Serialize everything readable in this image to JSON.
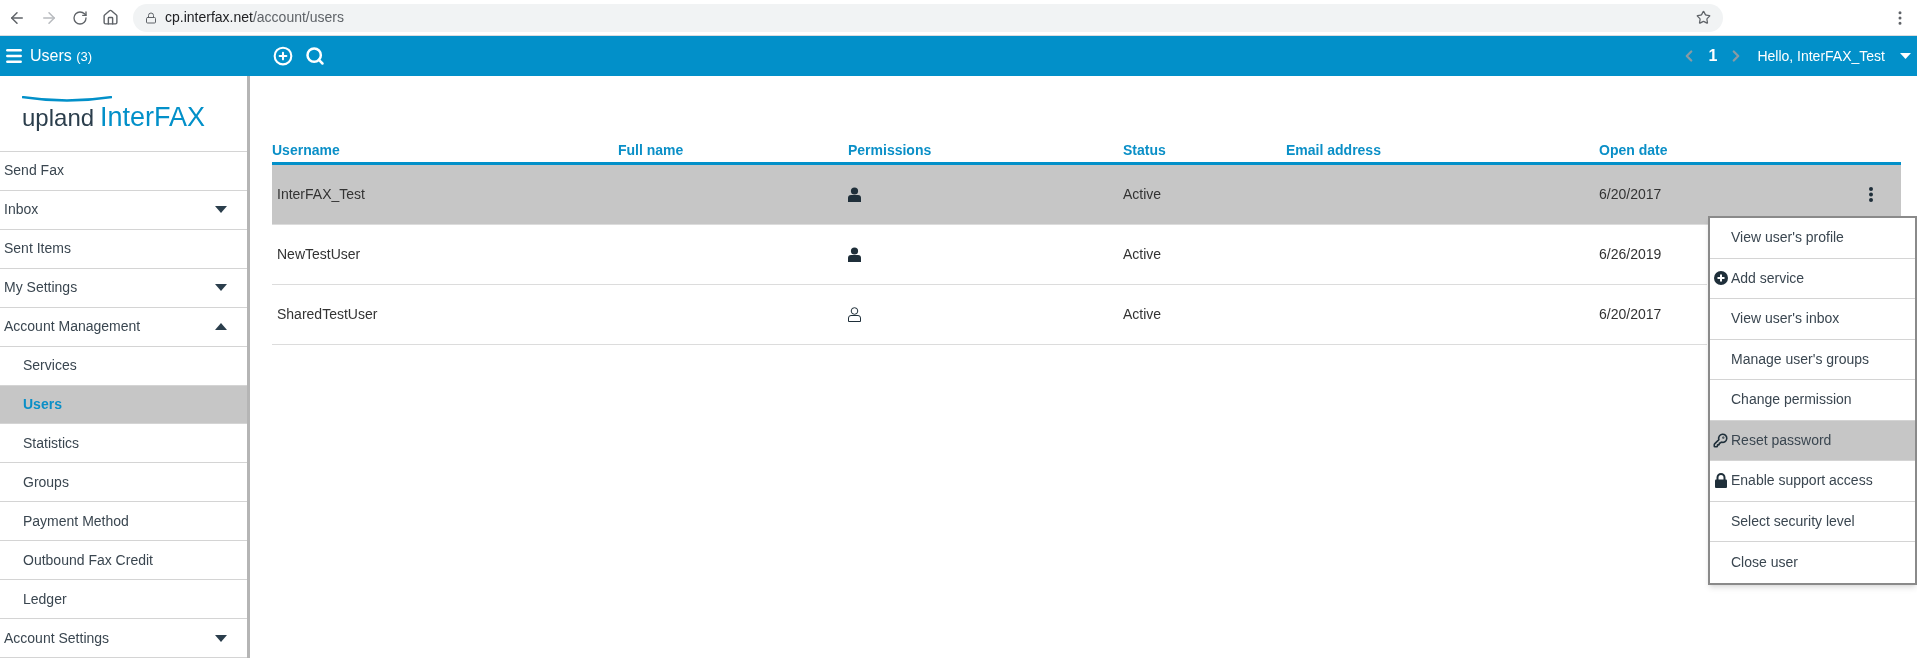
{
  "browser": {
    "url_host": "cp.interfax.net",
    "url_path": "/account/users"
  },
  "header": {
    "title": "Users",
    "count": "(3)",
    "page": "1",
    "greeting": "Hello, InterFAX_Test"
  },
  "logo": {
    "brand": "upland",
    "product": "InterFAX"
  },
  "sidebar": {
    "items": [
      {
        "label": "Send Fax",
        "selected": false
      },
      {
        "label": "Inbox",
        "selected": false,
        "expanded": false
      },
      {
        "label": "Sent Items",
        "selected": false
      },
      {
        "label": "My Settings",
        "selected": false,
        "expanded": false
      },
      {
        "label": "Account Management",
        "selected": false,
        "expanded": true,
        "children": [
          {
            "label": "Services",
            "selected": false
          },
          {
            "label": "Users",
            "selected": true
          },
          {
            "label": "Statistics",
            "selected": false
          },
          {
            "label": "Groups",
            "selected": false
          },
          {
            "label": "Payment Method",
            "selected": false
          },
          {
            "label": "Outbound Fax Credit",
            "selected": false
          },
          {
            "label": "Ledger",
            "selected": false
          }
        ]
      },
      {
        "label": "Account Settings",
        "selected": false,
        "expanded": false
      }
    ]
  },
  "table": {
    "columns": [
      "Username",
      "Full name",
      "Permissions",
      "Status",
      "Email address",
      "Open date"
    ],
    "rows": [
      {
        "username": "InterFAX_Test",
        "kind": "filled",
        "status": "Active",
        "open_date": "6/20/2017",
        "selected": true
      },
      {
        "username": "NewTestUser",
        "kind": "filled",
        "status": "Active",
        "open_date": "6/26/2019",
        "selected": false
      },
      {
        "username": "SharedTestUser",
        "kind": "outline",
        "status": "Active",
        "open_date": "6/20/2017",
        "selected": false
      }
    ]
  },
  "row_menu": {
    "items": [
      {
        "label": "View user's profile",
        "selected": false
      },
      {
        "label": "Add service",
        "kind": "plus",
        "selected": false
      },
      {
        "label": "View user's inbox",
        "selected": false
      },
      {
        "label": "Manage user's groups",
        "selected": false
      },
      {
        "label": "Change permission",
        "selected": false
      },
      {
        "label": "Reset password",
        "kind": "key",
        "selected": true
      },
      {
        "label": "Enable support access",
        "kind": "lock",
        "selected": false
      },
      {
        "label": "Select security level",
        "selected": false
      },
      {
        "label": "Close user",
        "selected": false
      }
    ]
  }
}
